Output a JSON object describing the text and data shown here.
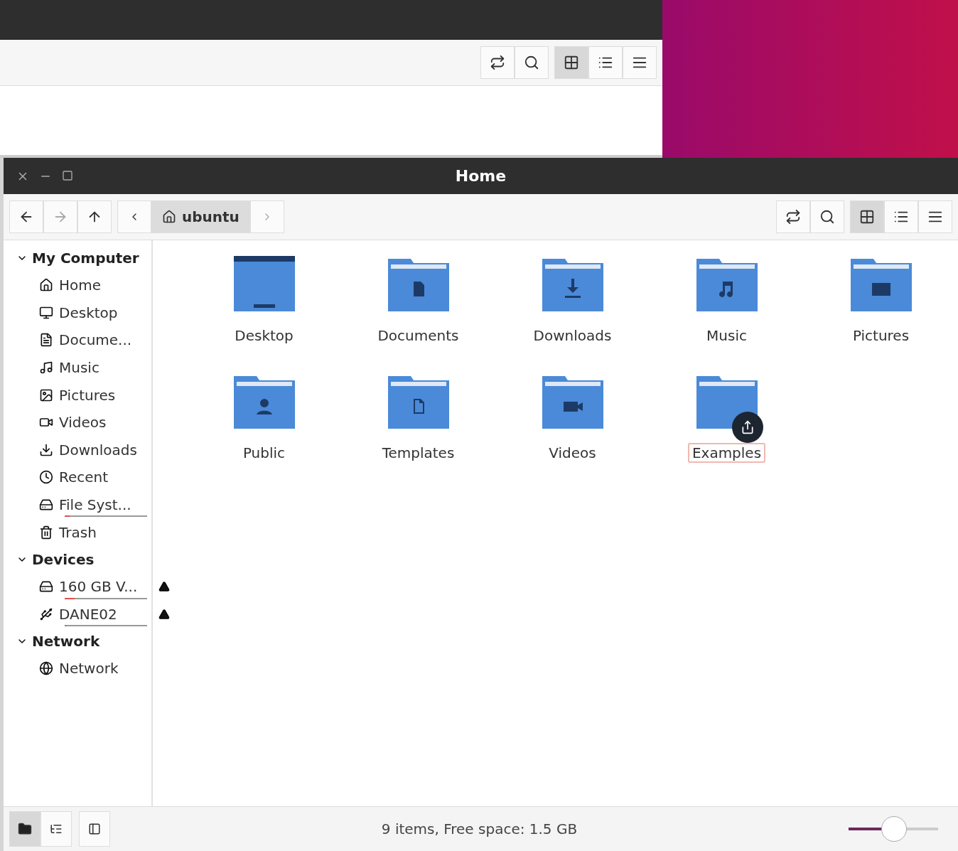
{
  "back_window": {
    "toolbar": [
      {
        "kind": "toggle",
        "selected": false
      },
      {
        "kind": "search",
        "selected": false
      },
      {
        "kind": "icons",
        "selected": true
      },
      {
        "kind": "list",
        "selected": false
      },
      {
        "kind": "compact",
        "selected": false
      }
    ]
  },
  "window": {
    "title": "Home"
  },
  "navigation": {
    "path": "ubuntu"
  },
  "view_buttons": [
    {
      "kind": "toggle",
      "selected": false
    },
    {
      "kind": "search",
      "selected": false
    },
    {
      "kind": "icons",
      "selected": true
    },
    {
      "kind": "list",
      "selected": false
    },
    {
      "kind": "compact",
      "selected": false
    }
  ],
  "sidebar": [
    {
      "title": "My Computer",
      "expanded": true,
      "items": [
        {
          "label": "Home",
          "kind": "home"
        },
        {
          "label": "Desktop",
          "kind": "desktop"
        },
        {
          "label": "Docume...",
          "kind": "document"
        },
        {
          "label": "Music",
          "kind": "music"
        },
        {
          "label": "Pictures",
          "kind": "pictures"
        },
        {
          "label": "Videos",
          "kind": "videos"
        },
        {
          "label": "Downloads",
          "kind": "downloads"
        },
        {
          "label": "Recent",
          "kind": "recent"
        },
        {
          "label": "File Syst...",
          "kind": "drive",
          "level": 0.06
        },
        {
          "label": "Trash",
          "kind": "trash"
        }
      ]
    },
    {
      "title": "Devices",
      "expanded": true,
      "items": [
        {
          "label": "160 GB V...",
          "kind": "drive",
          "level": 0.12,
          "ejectable": true
        },
        {
          "label": "DANE02",
          "kind": "usb",
          "level": 0.02,
          "ejectable": true
        }
      ]
    },
    {
      "title": "Network",
      "expanded": true,
      "items": [
        {
          "label": "Network",
          "kind": "network"
        }
      ]
    }
  ],
  "files": [
    {
      "label": "Desktop",
      "kind": "desktop",
      "selected": false,
      "link": false
    },
    {
      "label": "Documents",
      "kind": "document",
      "selected": false,
      "link": false
    },
    {
      "label": "Downloads",
      "kind": "downloads",
      "selected": false,
      "link": false
    },
    {
      "label": "Music",
      "kind": "music",
      "selected": false,
      "link": false
    },
    {
      "label": "Pictures",
      "kind": "pictures",
      "selected": false,
      "link": false
    },
    {
      "label": "Public",
      "kind": "public",
      "selected": false,
      "link": false
    },
    {
      "label": "Templates",
      "kind": "templates",
      "selected": false,
      "link": false
    },
    {
      "label": "Videos",
      "kind": "videos",
      "selected": false,
      "link": false
    },
    {
      "label": "Examples",
      "kind": "plain",
      "selected": true,
      "link": true
    }
  ],
  "status_bar": {
    "panes": [
      {
        "kind": "places",
        "selected": true
      },
      {
        "kind": "tree",
        "selected": false
      }
    ],
    "text": "9 items, Free space: 1.5 GB",
    "zoom": {
      "level": 0.5
    }
  }
}
